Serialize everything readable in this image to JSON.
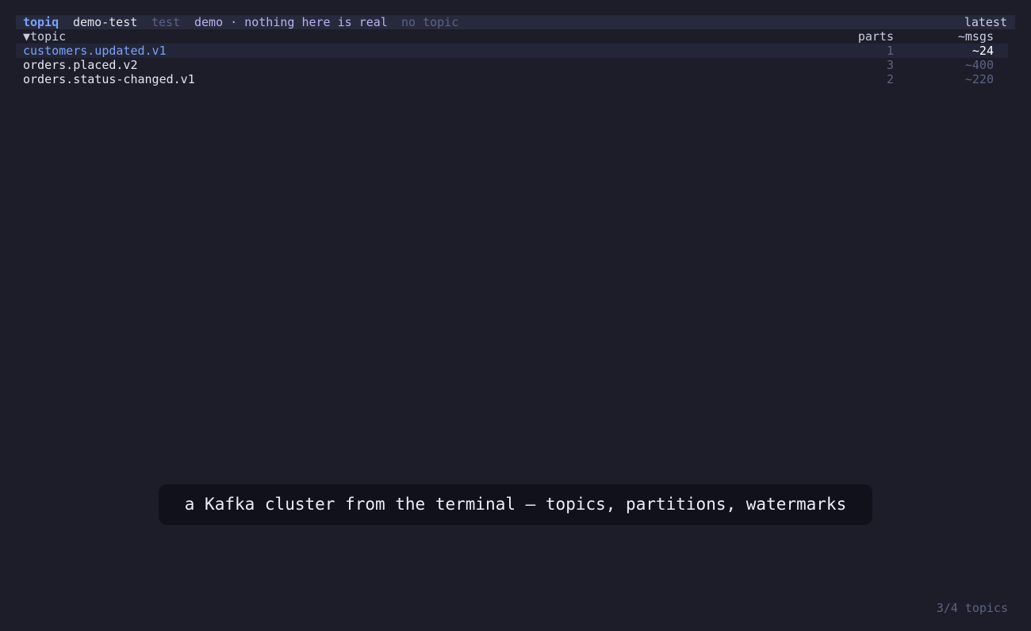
{
  "status_bar": {
    "app_name": "topiq",
    "profile": "demo-test",
    "environment": "test",
    "banner": "demo · nothing here is real",
    "selected_topic": "no topic",
    "mode": "latest"
  },
  "table": {
    "headers": {
      "name": "▼topic",
      "parts": "parts",
      "msgs": "~msgs"
    },
    "rows": [
      {
        "name": "customers.updated.v1",
        "parts": "1",
        "msgs": "~24"
      },
      {
        "name": "orders.placed.v2",
        "parts": "3",
        "msgs": "~400"
      },
      {
        "name": "orders.status-changed.v1",
        "parts": "2",
        "msgs": "~220"
      }
    ]
  },
  "caption": "a Kafka cluster from the terminal — topics, partitions, watermarks",
  "footer": {
    "count": "3/4 topics"
  },
  "colors": {
    "background": "#1c1d28",
    "accent": "#7aa2f7",
    "muted": "#5d6283",
    "banner": "#b9b3f0"
  }
}
